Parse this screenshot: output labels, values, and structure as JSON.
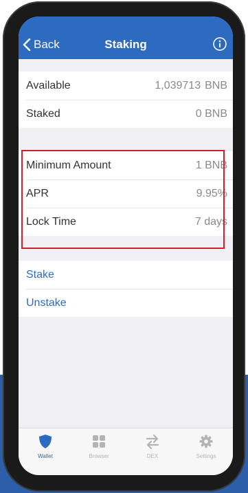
{
  "header": {
    "back_label": "Back",
    "title": "Staking"
  },
  "balances": [
    {
      "label": "Available",
      "amount": "1,039713",
      "unit": "BNB"
    },
    {
      "label": "Staked",
      "amount": "0",
      "unit": "BNB"
    }
  ],
  "details": [
    {
      "label": "Minimum Amount",
      "value": "1 BNB"
    },
    {
      "label": "APR",
      "value": "9.95%"
    },
    {
      "label": "Lock Time",
      "value": "7 days"
    }
  ],
  "actions": {
    "stake_label": "Stake",
    "unstake_label": "Unstake"
  },
  "tabs": [
    {
      "label": "Wallet",
      "icon": "shield-icon",
      "active": true
    },
    {
      "label": "Browser",
      "icon": "grid-icon",
      "active": false
    },
    {
      "label": "DEX",
      "icon": "swap-arrows-icon",
      "active": false
    },
    {
      "label": "Settings",
      "icon": "gear-icon",
      "active": false
    }
  ],
  "colors": {
    "accent": "#2d6bc1",
    "highlight_border": "#d0202b",
    "background_band": "#2d5fa8"
  }
}
